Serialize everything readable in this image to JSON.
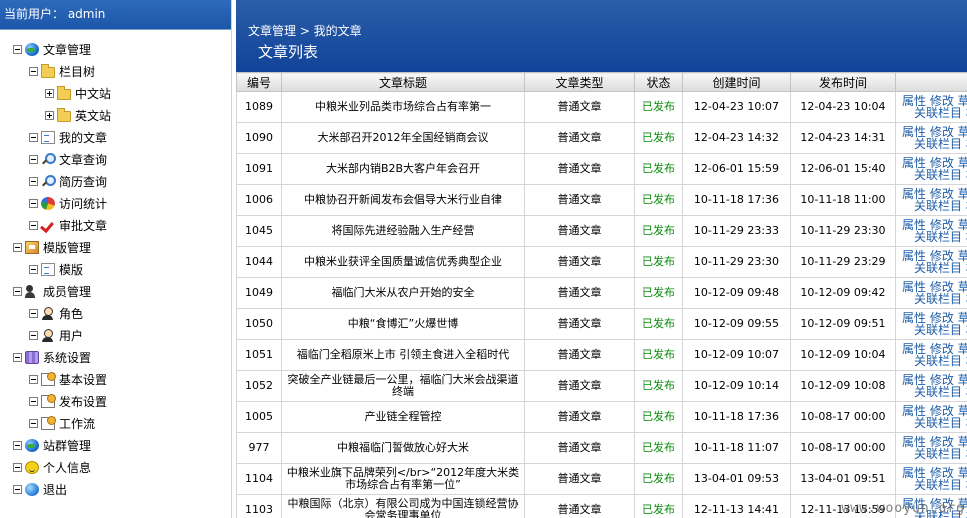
{
  "user_bar": {
    "text": "当前用户： admin"
  },
  "tree": [
    {
      "label": "文章管理",
      "icon": "globe",
      "box": "minus",
      "level": 0
    },
    {
      "label": "栏目树",
      "icon": "folder",
      "box": "minus",
      "level": 1
    },
    {
      "label": "中文站",
      "icon": "folder",
      "box": "plus",
      "level": 2
    },
    {
      "label": "英文站",
      "icon": "folder",
      "box": "plus",
      "level": 2
    },
    {
      "label": "我的文章",
      "icon": "doc",
      "box": "dot",
      "level": 1
    },
    {
      "label": "文章查询",
      "icon": "search",
      "box": "dot",
      "level": 1
    },
    {
      "label": "简历查询",
      "icon": "search",
      "box": "dot",
      "level": 1
    },
    {
      "label": "访问统计",
      "icon": "chart",
      "box": "dot",
      "level": 1
    },
    {
      "label": "审批文章",
      "icon": "check",
      "box": "dot",
      "level": 1
    },
    {
      "label": "模版管理",
      "icon": "tmpl",
      "box": "minus",
      "level": 0
    },
    {
      "label": "模版",
      "icon": "doc",
      "box": "dot",
      "level": 1
    },
    {
      "label": "成员管理",
      "icon": "users",
      "box": "minus",
      "level": 0
    },
    {
      "label": "角色",
      "icon": "user",
      "box": "dot",
      "level": 1
    },
    {
      "label": "用户",
      "icon": "user",
      "box": "dot",
      "level": 1
    },
    {
      "label": "系统设置",
      "icon": "gear",
      "box": "minus",
      "level": 0
    },
    {
      "label": "基本设置",
      "icon": "settings",
      "box": "dot",
      "level": 1
    },
    {
      "label": "发布设置",
      "icon": "settings",
      "box": "dot",
      "level": 1
    },
    {
      "label": "工作流",
      "icon": "settings",
      "box": "dot",
      "level": 1
    },
    {
      "label": "站群管理",
      "icon": "globe",
      "box": "dot",
      "level": 0
    },
    {
      "label": "个人信息",
      "icon": "smile",
      "box": "dot",
      "level": 0
    },
    {
      "label": "退出",
      "icon": "logout",
      "box": "dot",
      "level": 0
    }
  ],
  "header": {
    "breadcrumb": "文章管理 > 我的文章",
    "title": "文章列表"
  },
  "table": {
    "columns": [
      "编号",
      "文章标题",
      "文章类型",
      "状态",
      "创建时间",
      "发布时间",
      ""
    ],
    "rows": [
      [
        "1089",
        "中粮米业列品类市场综合占有率第一",
        "普通文章",
        "已发布",
        "12-04-23 10:07",
        "12-04-23 10:04"
      ],
      [
        "1090",
        "大米部召开2012年全国经销商会议",
        "普通文章",
        "已发布",
        "12-04-23 14:32",
        "12-04-23 14:31"
      ],
      [
        "1091",
        "大米部内销B2B大客户年会召开",
        "普通文章",
        "已发布",
        "12-06-01 15:59",
        "12-06-01 15:40"
      ],
      [
        "1006",
        "中粮协召开新闻发布会倡导大米行业自律",
        "普通文章",
        "已发布",
        "10-11-18 17:36",
        "10-11-18 11:00"
      ],
      [
        "1045",
        "将国际先进经验融入生产经营",
        "普通文章",
        "已发布",
        "10-11-29 23:33",
        "10-11-29 23:30"
      ],
      [
        "1044",
        "中粮米业获评全国质量诚信优秀典型企业",
        "普通文章",
        "已发布",
        "10-11-29 23:30",
        "10-11-29 23:29"
      ],
      [
        "1049",
        "福临门大米从农户开始的安全",
        "普通文章",
        "已发布",
        "10-12-09 09:48",
        "10-12-09 09:42"
      ],
      [
        "1050",
        "中粮“食博汇”火爆世博",
        "普通文章",
        "已发布",
        "10-12-09 09:55",
        "10-12-09 09:51"
      ],
      [
        "1051",
        "福临门全稻原米上市 引领主食进入全稻时代",
        "普通文章",
        "已发布",
        "10-12-09 10:07",
        "10-12-09 10:04"
      ],
      [
        "1052",
        "突破全产业链最后一公里，福临门大米会战渠道终端",
        "普通文章",
        "已发布",
        "10-12-09 10:14",
        "10-12-09 10:08"
      ],
      [
        "1005",
        "产业链全程管控",
        "普通文章",
        "已发布",
        "10-11-18 17:36",
        "10-08-17 00:00"
      ],
      [
        "977",
        "中粮福临门誓做放心好大米",
        "普通文章",
        "已发布",
        "10-11-18 11:07",
        "10-08-17 00:00"
      ],
      [
        "1104",
        "中粮米业旗下品牌荣列</br>“2012年度大米类市场综合占有率第一位”",
        "普通文章",
        "已发布",
        "13-04-01 09:53",
        "13-04-01 09:51"
      ],
      [
        "1103",
        "中粮国际（北京）有限公司成为中国连锁经营协会常务理事单位",
        "普通文章",
        "已发布",
        "12-11-13 14:41",
        "12-11-13 15:59"
      ]
    ],
    "ops_line1": "属性 修改 草",
    "ops_line2": "关联栏目 相"
  },
  "watermark": "www.wooyun.org"
}
